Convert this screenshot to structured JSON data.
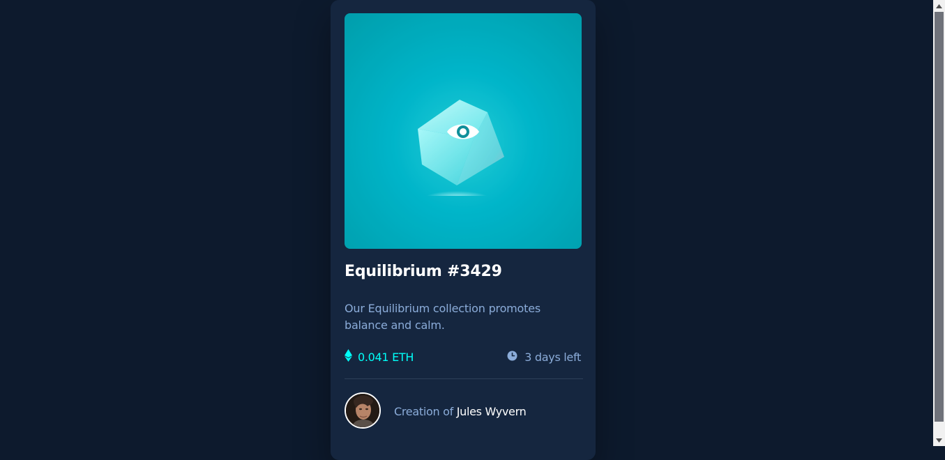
{
  "card": {
    "title": "Equilibrium #3429",
    "description": "Our Equilibrium collection promotes balance and calm.",
    "price": "0.041 ETH",
    "time_left": "3 days left",
    "creator_prefix": "Creation of",
    "creator_name": "Jules Wyvern"
  },
  "icons": {
    "hero_overlay": "eye-icon",
    "price": "ethereum-icon",
    "time": "clock-icon",
    "scroll_up": "chevron-up-icon",
    "scroll_down": "chevron-down-icon"
  },
  "colors": {
    "page_background": "#0d1a2d",
    "card_background": "#15263f",
    "accent_cyan": "#00fff8",
    "muted_text": "#8bacd9",
    "heading_text": "#ffffff",
    "divider": "#2e405a"
  }
}
